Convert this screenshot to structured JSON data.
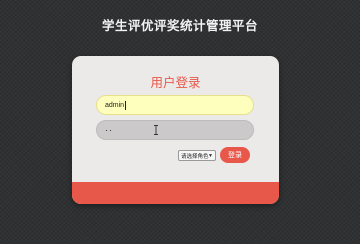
{
  "app": {
    "title": "学生评优评奖统计管理平台"
  },
  "login": {
    "title": "用户登录",
    "username_value": "admin",
    "password_masked": "··",
    "role_select_value": "请选择角色",
    "login_button_label": "登录"
  },
  "colors": {
    "accent": "#e8584a",
    "page_background": "#2f3133",
    "card_background": "#ece9e9",
    "username_field_background": "#ffffbd",
    "password_field_background": "#cbc9c9"
  },
  "icons": {
    "cursor": "text-cursor-icon",
    "select_arrow": "chevron-down-icon"
  }
}
